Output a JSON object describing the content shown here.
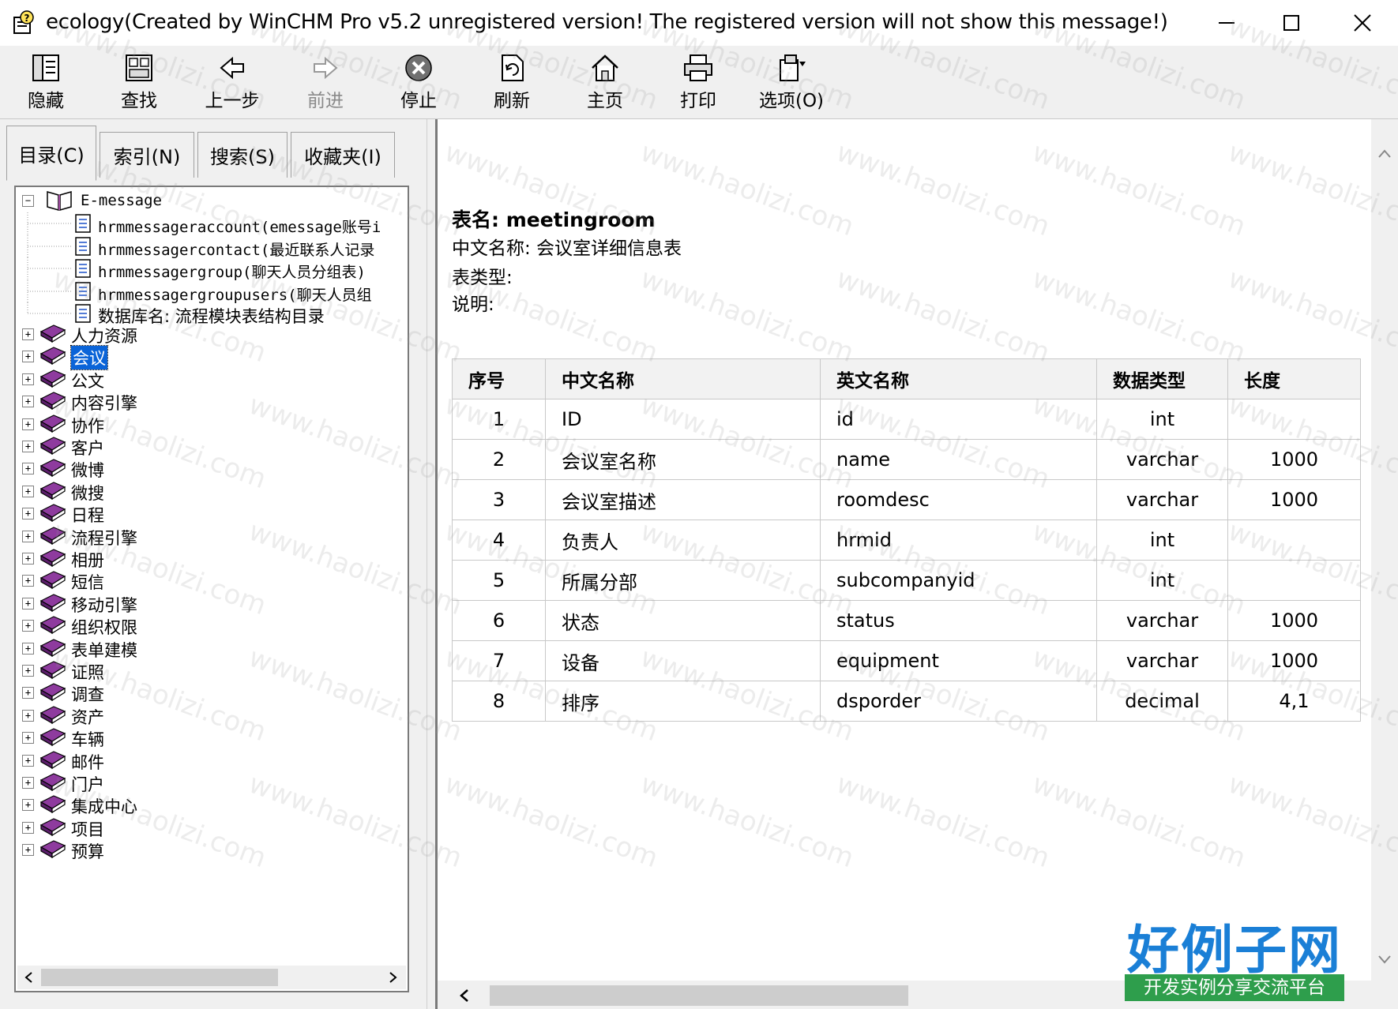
{
  "window": {
    "title": "ecology(Created by WinCHM Pro v5.2 unregistered version! The registered version will not show this message!)"
  },
  "toolbar": {
    "hide": "隐藏",
    "find": "查找",
    "back": "上一步",
    "forward": "前进",
    "stop": "停止",
    "refresh": "刷新",
    "home": "主页",
    "print": "打印",
    "options": "选项(O)"
  },
  "tabs": {
    "contents": "目录(C)",
    "index": "索引(N)",
    "search": "搜索(S)",
    "favorites": "收藏夹(I)"
  },
  "tree": {
    "root": "E-message",
    "children": [
      "hrmmessageraccount(emessage账号i",
      "hrmmessagercontact(最近联系人记录",
      "hrmmessagergroup(聊天人员分组表)",
      "hrmmessagergroupusers(聊天人员组",
      "数据库名: 流程模块表结构目录"
    ],
    "books": [
      "人力资源",
      "会议",
      "公文",
      "内容引擎",
      "协作",
      "客户",
      "微博",
      "微搜",
      "日程",
      "流程引擎",
      "相册",
      "短信",
      "移动引擎",
      "组织权限",
      "表单建模",
      "证照",
      "调查",
      "资产",
      "车辆",
      "邮件",
      "门户",
      "集成中心",
      "项目",
      "预算"
    ],
    "selected": "会议"
  },
  "content": {
    "table_name": "表名: meetingroom",
    "cn_name": "中文名称: 会议室详细信息表",
    "table_type": "表类型:",
    "description": "说明:",
    "headers": [
      "序号",
      "中文名称",
      "英文名称",
      "数据类型",
      "长度"
    ],
    "rows": [
      [
        "1",
        "ID",
        "id",
        "int",
        ""
      ],
      [
        "2",
        "会议室名称",
        "name",
        "varchar",
        "1000"
      ],
      [
        "3",
        "会议室描述",
        "roomdesc",
        "varchar",
        "1000"
      ],
      [
        "4",
        "负责人",
        "hrmid",
        "int",
        ""
      ],
      [
        "5",
        "所属分部",
        "subcompanyid",
        "int",
        ""
      ],
      [
        "6",
        "状态",
        "status",
        "varchar",
        "1000"
      ],
      [
        "7",
        "设备",
        "equipment",
        "varchar",
        "1000"
      ],
      [
        "8",
        "排序",
        "dsporder",
        "decimal",
        "4,1"
      ]
    ]
  },
  "watermark": {
    "text": "www.haolizi.com",
    "logo_main": "好例子网",
    "logo_sub": "开发实例分享交流平台"
  }
}
